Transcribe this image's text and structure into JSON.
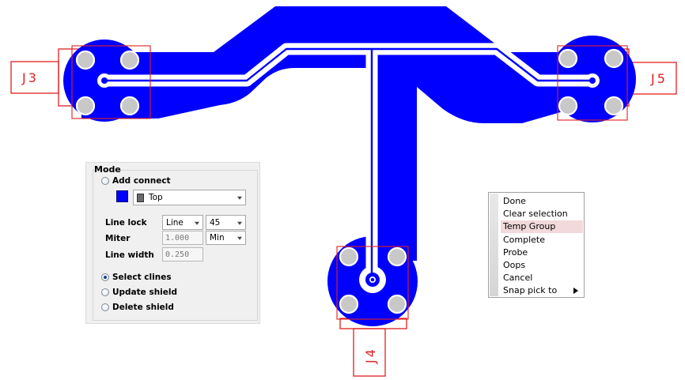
{
  "colors": {
    "copper": "#0000ff",
    "clearance": "#ffffff",
    "outline": "#e02020",
    "pad": "#c8c8c8"
  },
  "components": [
    {
      "ref": "J3"
    },
    {
      "ref": "J5"
    },
    {
      "ref": "J4"
    }
  ],
  "mode_panel": {
    "title": "Mode",
    "add_connect": {
      "label": "Add connect",
      "checked": false
    },
    "layer": {
      "value": "Top",
      "icon": "layer-color-chip"
    },
    "line_lock": {
      "label": "Line lock",
      "type": "Line",
      "angle": "45"
    },
    "miter": {
      "label": "Miter",
      "value": "1.000",
      "unit": "Min"
    },
    "line_width": {
      "label": "Line width",
      "value": "0.250"
    },
    "select_clines": {
      "label": "Select clines",
      "checked": true
    },
    "update_shield": {
      "label": "Update shield",
      "checked": false
    },
    "delete_shield": {
      "label": "Delete shield",
      "checked": false
    }
  },
  "context_menu": {
    "items": [
      "Done",
      "Clear selection",
      "Temp Group",
      "Complete",
      "Probe",
      "Oops",
      "Cancel",
      "Snap pick to"
    ],
    "highlighted": "Temp Group",
    "submenu_item": "Snap pick to"
  }
}
